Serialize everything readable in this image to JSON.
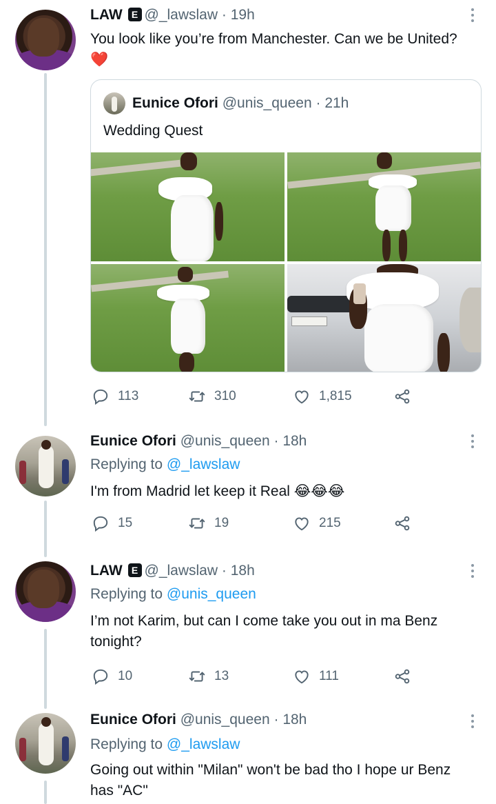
{
  "tweets": [
    {
      "name": "LAW",
      "badge": "E",
      "handle": "@_lawslaw",
      "time": "19h",
      "text": "You look like you’re from Manchester. Can we be United? ❤️",
      "quote": {
        "name": "Eunice Ofori",
        "handle": "@unis_queen",
        "time": "21h",
        "text": "Wedding Quest",
        "photos": 4
      },
      "stats": {
        "replies": "113",
        "retweets": "310",
        "likes": "1,815"
      }
    },
    {
      "name": "Eunice Ofori",
      "handle": "@unis_queen",
      "time": "18h",
      "replying_label": "Replying to",
      "replying_to": "@_lawslaw",
      "text": "I'm from Madrid let keep it Real 😂😂😂",
      "stats": {
        "replies": "15",
        "retweets": "19",
        "likes": "215"
      }
    },
    {
      "name": "LAW",
      "badge": "E",
      "handle": "@_lawslaw",
      "time": "18h",
      "replying_label": "Replying to",
      "replying_to": "@unis_queen",
      "text": "I’m not Karim, but can I come take you out in ma Benz tonight?",
      "stats": {
        "replies": "10",
        "retweets": "13",
        "likes": "111"
      }
    },
    {
      "name": "Eunice Ofori",
      "handle": "@unis_queen",
      "time": "18h",
      "replying_label": "Replying to",
      "replying_to": "@_lawslaw",
      "text": "Going out within \"Milan\" won't be bad tho I hope ur Benz has \"AC\""
    }
  ],
  "separator": "·",
  "icons": {
    "reply": "reply-icon",
    "retweet": "retweet-icon",
    "like": "heart-icon",
    "share": "share-icon",
    "more": "more-vertical-icon"
  },
  "colors": {
    "text": "#0f1419",
    "muted": "#536471",
    "link": "#1d9bf0",
    "thread_line": "#cfd9de"
  }
}
